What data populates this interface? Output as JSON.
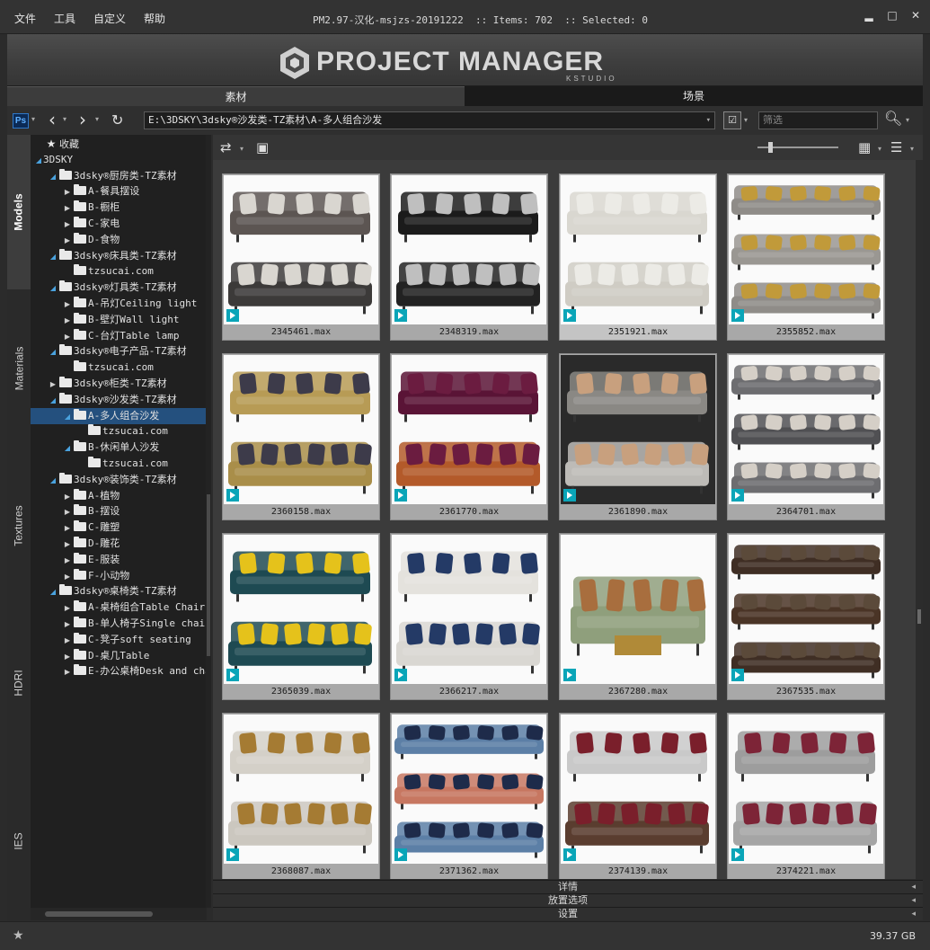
{
  "menu": [
    "文件",
    "工具",
    "自定义",
    "帮助"
  ],
  "window_title": "PM2.97-汉化-msjzs-20191222  :: Items: 702  :: Selected: 0",
  "window_controls": [
    "minimize-icon",
    "maximize-icon",
    "close-icon"
  ],
  "logo": {
    "text": "PROJECT MANAGER",
    "sub": "KSTUDIO"
  },
  "top_tabs": [
    {
      "label": "素材",
      "active": true
    },
    {
      "label": "场景",
      "active": false
    }
  ],
  "address": {
    "ps_label": "Ps",
    "path": "E:\\3DSKY\\3dsky®沙发类-TZ素材\\A-多人组合沙发",
    "filter_placeholder": "筛选"
  },
  "side_tabs": [
    "Models",
    "Materials",
    "Textures",
    "HDRI",
    "IES"
  ],
  "tree": [
    {
      "label": "收藏",
      "indent": 0,
      "arrow": "",
      "icon": "star"
    },
    {
      "label": "3DSKY",
      "indent": 0,
      "arrow": "open",
      "icon": "none"
    },
    {
      "label": "3dsky®厨房类-TZ素材",
      "indent": 1,
      "arrow": "open",
      "icon": "folder"
    },
    {
      "label": "A-餐具摆设",
      "indent": 2,
      "arrow": "closed",
      "icon": "folder"
    },
    {
      "label": "B-橱柜",
      "indent": 2,
      "arrow": "closed",
      "icon": "folder"
    },
    {
      "label": "C-家电",
      "indent": 2,
      "arrow": "closed",
      "icon": "folder"
    },
    {
      "label": "D-食物",
      "indent": 2,
      "arrow": "closed",
      "icon": "folder"
    },
    {
      "label": "3dsky®床具类-TZ素材",
      "indent": 1,
      "arrow": "open",
      "icon": "folder"
    },
    {
      "label": "tzsucai.com",
      "indent": 2,
      "arrow": "",
      "icon": "folder"
    },
    {
      "label": "3dsky®灯具类-TZ素材",
      "indent": 1,
      "arrow": "open",
      "icon": "folder"
    },
    {
      "label": "A-吊灯Ceiling light",
      "indent": 2,
      "arrow": "closed",
      "icon": "folder"
    },
    {
      "label": "B-壁灯Wall light",
      "indent": 2,
      "arrow": "closed",
      "icon": "folder"
    },
    {
      "label": "C-台灯Table lamp",
      "indent": 2,
      "arrow": "closed",
      "icon": "folder"
    },
    {
      "label": "3dsky®电子产品-TZ素材",
      "indent": 1,
      "arrow": "open",
      "icon": "folder"
    },
    {
      "label": "tzsucai.com",
      "indent": 2,
      "arrow": "",
      "icon": "folder"
    },
    {
      "label": "3dsky®柜类-TZ素材",
      "indent": 1,
      "arrow": "closed",
      "icon": "folder"
    },
    {
      "label": "3dsky®沙发类-TZ素材",
      "indent": 1,
      "arrow": "open",
      "icon": "folder"
    },
    {
      "label": "A-多人组合沙发",
      "indent": 2,
      "arrow": "open",
      "icon": "folder",
      "selected": true
    },
    {
      "label": "tzsucai.com",
      "indent": 3,
      "arrow": "",
      "icon": "folder"
    },
    {
      "label": "B-休闲单人沙发",
      "indent": 2,
      "arrow": "open",
      "icon": "folder"
    },
    {
      "label": "tzsucai.com",
      "indent": 3,
      "arrow": "",
      "icon": "folder"
    },
    {
      "label": "3dsky®装饰类-TZ素材",
      "indent": 1,
      "arrow": "open",
      "icon": "folder"
    },
    {
      "label": "A-植物",
      "indent": 2,
      "arrow": "closed",
      "icon": "folder"
    },
    {
      "label": "B-摆设",
      "indent": 2,
      "arrow": "closed",
      "icon": "folder"
    },
    {
      "label": "C-雕塑",
      "indent": 2,
      "arrow": "closed",
      "icon": "folder"
    },
    {
      "label": "D-雕花",
      "indent": 2,
      "arrow": "closed",
      "icon": "folder"
    },
    {
      "label": "E-服装",
      "indent": 2,
      "arrow": "closed",
      "icon": "folder"
    },
    {
      "label": "F-小动物",
      "indent": 2,
      "arrow": "closed",
      "icon": "folder"
    },
    {
      "label": "3dsky®桌椅类-TZ素材",
      "indent": 1,
      "arrow": "open",
      "icon": "folder"
    },
    {
      "label": "A-桌椅组合Table Chair",
      "indent": 2,
      "arrow": "closed",
      "icon": "folder"
    },
    {
      "label": "B-单人椅子Single chair",
      "indent": 2,
      "arrow": "closed",
      "icon": "folder"
    },
    {
      "label": "C-凳子soft seating",
      "indent": 2,
      "arrow": "closed",
      "icon": "folder"
    },
    {
      "label": "D-桌几Table",
      "indent": 2,
      "arrow": "closed",
      "icon": "folder"
    },
    {
      "label": "E-办公桌椅Desk and chair",
      "indent": 2,
      "arrow": "closed",
      "icon": "folder"
    }
  ],
  "items": [
    {
      "label": "2345461.max",
      "sofa": "#5c5552",
      "sofa2": "#3c3a39",
      "pillow": "#d9d6d0",
      "style": "double"
    },
    {
      "label": "2348319.max",
      "sofa": "#1b1b1b",
      "sofa2": "#222222",
      "pillow": "#bfbfbf",
      "style": "double"
    },
    {
      "label": "2351921.max",
      "sofa": "#d9d7d0",
      "sofa2": "#cfccc4",
      "pillow": "#ecebe6",
      "style": "double",
      "highlight": true
    },
    {
      "label": "2355852.max",
      "sofa": "#8f8c88",
      "sofa2": "#9a9792",
      "pillow": "#c19a3a",
      "style": "triple"
    },
    {
      "label": "2360158.max",
      "sofa": "#b79b55",
      "sofa2": "#a98e49",
      "pillow": "#3d3b4a",
      "style": "double"
    },
    {
      "label": "2361770.max",
      "sofa": "#5a1436",
      "sofa2": "#b35a2a",
      "pillow": "#6b1c40",
      "style": "double"
    },
    {
      "label": "2361890.max",
      "sofa": "#8a8884",
      "sofa2": "#bdbbb7",
      "pillow": "#c8a07e",
      "style": "double",
      "dark": true
    },
    {
      "label": "2364701.max",
      "sofa": "#6d6d70",
      "sofa2": "#505053",
      "pillow": "#d5cfc7",
      "style": "triple"
    },
    {
      "label": "2365039.max",
      "sofa": "#1e4a52",
      "sofa2": "#1e4a52",
      "pillow": "#e5c21b",
      "style": "double"
    },
    {
      "label": "2366217.max",
      "sofa": "#e4e2dd",
      "sofa2": "#d9d7d2",
      "pillow": "#243a66",
      "style": "double"
    },
    {
      "label": "2367280.max",
      "sofa": "#8f9f7c",
      "sofa2": "#b08a38",
      "pillow": "#a86e3e",
      "style": "single"
    },
    {
      "label": "2367535.max",
      "sofa": "#3f2e24",
      "sofa2": "#4a3426",
      "pillow": "#5b4a3a",
      "style": "triple"
    },
    {
      "label": "2368087.max",
      "sofa": "#d4d0c8",
      "sofa2": "#cbc7bf",
      "pillow": "#a57b33",
      "style": "double"
    },
    {
      "label": "2371362.max",
      "sofa": "#5c7fa6",
      "sofa2": "#c77761",
      "pillow": "#1e2b4a",
      "style": "triple"
    },
    {
      "label": "2374139.max",
      "sofa": "#c9c9c9",
      "sofa2": "#5a3d2f",
      "pillow": "#7a1f2b",
      "style": "double"
    },
    {
      "label": "2374221.max",
      "sofa": "#9d9d9d",
      "sofa2": "#a5a5a5",
      "pillow": "#7d2437",
      "style": "double"
    }
  ],
  "bottom_panels": [
    "详情",
    "放置选项",
    "设置"
  ],
  "status": {
    "size": "39.37 GB"
  }
}
